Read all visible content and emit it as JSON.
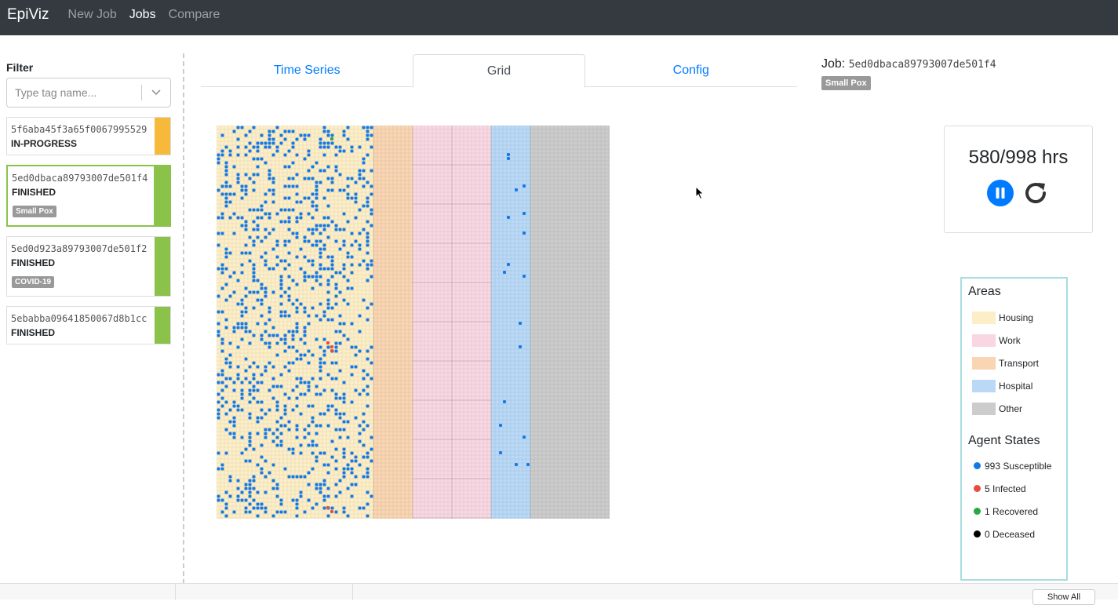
{
  "navbar": {
    "brand": "EpiViz",
    "links": [
      {
        "label": "New Job",
        "active": false
      },
      {
        "label": "Jobs",
        "active": true
      },
      {
        "label": "Compare",
        "active": false
      }
    ]
  },
  "sidebar": {
    "filter_label": "Filter",
    "filter_placeholder": "Type tag name...",
    "jobs": [
      {
        "id": "5f6aba45f3a65f0067995529",
        "status": "IN-PROGRESS",
        "tag": "",
        "bar_color": "#f6b93b",
        "selected": false
      },
      {
        "id": "5ed0dbaca89793007de501f4",
        "status": "FINISHED",
        "tag": "Small Pox",
        "bar_color": "#8bc34a",
        "selected": true
      },
      {
        "id": "5ed0d923a89793007de501f2",
        "status": "FINISHED",
        "tag": "COVID-19",
        "bar_color": "#8bc34a",
        "selected": false
      },
      {
        "id": "5ebabba09641850067d8b1cc",
        "status": "FINISHED",
        "tag": "",
        "bar_color": "#8bc34a",
        "selected": false
      }
    ]
  },
  "tabs": [
    {
      "label": "Time Series",
      "active": false
    },
    {
      "label": "Grid",
      "active": true
    },
    {
      "label": "Config",
      "active": false
    }
  ],
  "job_header": {
    "label": "Job:",
    "id": "5ed0dbaca89793007de501f4",
    "tag": "Small Pox"
  },
  "timer": {
    "text": "580/998 hrs",
    "pause_color": "#007bff"
  },
  "legend": {
    "areas_title": "Areas",
    "areas": [
      {
        "label": "Housing",
        "color": "#fcefc7"
      },
      {
        "label": "Work",
        "color": "#f8d7e3"
      },
      {
        "label": "Transport",
        "color": "#f9d5b3"
      },
      {
        "label": "Hospital",
        "color": "#b9d9f7"
      },
      {
        "label": "Other",
        "color": "#cccccc"
      }
    ],
    "states_title": "Agent States",
    "states": [
      {
        "label": "993 Susceptible",
        "color": "#1479e6"
      },
      {
        "label": "5 Infected",
        "color": "#e74c3c"
      },
      {
        "label": "1 Recovered",
        "color": "#28a745"
      },
      {
        "label": "0 Deceased",
        "color": "#000000"
      }
    ]
  },
  "grid": {
    "zones": [
      {
        "area": "Housing",
        "color": "#fcefc7"
      },
      {
        "area": "Transport",
        "color": "#f9d5b3"
      },
      {
        "area": "Work",
        "color": "#f8d7e3"
      },
      {
        "area": "Work",
        "color": "#f8d7e3"
      },
      {
        "area": "Hospital",
        "color": "#b9d9f7"
      },
      {
        "area": "Other",
        "color": "#cccccc"
      },
      {
        "area": "Other",
        "color": "#cccccc"
      }
    ]
  },
  "bottom_bar": {
    "show_all": "Show All"
  }
}
